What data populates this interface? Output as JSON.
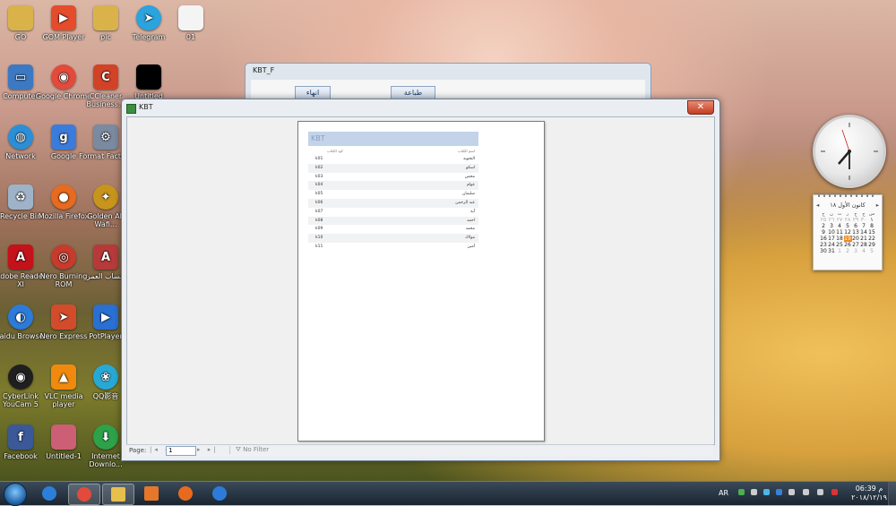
{
  "desktop": {
    "icons": [
      {
        "label": "GO",
        "icon": "folder-icon",
        "color": "#d9b34a"
      },
      {
        "label": "GOM Player",
        "icon": "gom-player-icon",
        "color": "#e44c2c"
      },
      {
        "label": "pic",
        "icon": "folder-icon",
        "color": "#d9b34a"
      },
      {
        "label": "Telegram",
        "icon": "telegram-icon",
        "color": "#2aa3de"
      },
      {
        "label": "01",
        "icon": "document-icon",
        "color": "#f4f4f4"
      },
      {
        "label": "Computer",
        "icon": "computer-icon",
        "color": "#3d79c2"
      },
      {
        "label": "Google Chrome",
        "icon": "chrome-icon",
        "color": "#e24b3b"
      },
      {
        "label": "CCleaner Business...",
        "icon": "ccleaner-icon",
        "color": "#d24226"
      },
      {
        "label": "Untitled",
        "icon": "black-image-icon",
        "color": "#000000"
      },
      {
        "label": "Network",
        "icon": "network-icon",
        "color": "#2b8fd8"
      },
      {
        "label": "Google",
        "icon": "google-icon",
        "color": "#3b7cdb"
      },
      {
        "label": "Format Factory",
        "icon": "format-factory-icon",
        "color": "#7a8aa0"
      },
      {
        "label": "Recycle Bin",
        "icon": "recycle-bin-icon",
        "color": "#9fb3c8"
      },
      {
        "label": "Mozilla Firefox",
        "icon": "firefox-icon",
        "color": "#e86a1e"
      },
      {
        "label": "Golden Al-Wafi...",
        "icon": "golden-al-wafi-icon",
        "color": "#c8951c"
      },
      {
        "label": "Adobe Reader XI",
        "icon": "adobe-reader-icon",
        "color": "#c4121a"
      },
      {
        "label": "Nero Burning ROM",
        "icon": "nero-icon",
        "color": "#c63b2c"
      },
      {
        "label": "حساب العمر",
        "icon": "access-file-icon",
        "color": "#b73a3a"
      },
      {
        "label": "Baidu Browser",
        "icon": "baidu-browser-icon",
        "color": "#2d7bd8"
      },
      {
        "label": "Nero Express",
        "icon": "nero-express-icon",
        "color": "#d24c2c"
      },
      {
        "label": "PotPlayer",
        "icon": "potplayer-icon",
        "color": "#2a6fd2"
      },
      {
        "label": "CyberLink YouCam 5",
        "icon": "youcam-icon",
        "color": "#1f1f1f"
      },
      {
        "label": "VLC media player",
        "icon": "vlc-icon",
        "color": "#f08a0e"
      },
      {
        "label": "QQ影音",
        "icon": "qq-player-icon",
        "color": "#27a9d6"
      },
      {
        "label": "Facebook",
        "icon": "facebook-icon",
        "color": "#3b5998"
      },
      {
        "label": "Untitled-1",
        "icon": "photoshop-file-icon",
        "color": "#cc5f75"
      },
      {
        "label": "Internet Downlo...",
        "icon": "internet-download-manager-icon",
        "color": "#2ea24a"
      }
    ]
  },
  "kbt_f_window": {
    "title": "KBT_F",
    "buttons": [
      "انهاء",
      "طباعة"
    ]
  },
  "report_window": {
    "title": "KBT",
    "close_glyph": "✕",
    "report": {
      "header": "KBT",
      "columns": [
        "كود الكتاب",
        "اسم الكتاب"
      ],
      "rows": [
        {
          "code": "k01",
          "name": "النحويه"
        },
        {
          "code": "k02",
          "name": "اسكو"
        },
        {
          "code": "k03",
          "name": "محمن"
        },
        {
          "code": "k04",
          "name": "عوام"
        },
        {
          "code": "k05",
          "name": "سلیمان"
        },
        {
          "code": "k06",
          "name": "عبد الرحمن"
        },
        {
          "code": "k07",
          "name": "آیة"
        },
        {
          "code": "k08",
          "name": "احمد"
        },
        {
          "code": "k09",
          "name": "محمد"
        },
        {
          "code": "k10",
          "name": "مولاك"
        },
        {
          "code": "k11",
          "name": "آمين"
        }
      ]
    },
    "navigation": {
      "page_label": "Page:",
      "page_value": "1",
      "filter_label": "No Filter"
    }
  },
  "gadgets": {
    "calendar": {
      "month": "كانون الأول ١٨",
      "weekdays": [
        "ح",
        "ن",
        "ث",
        "ر",
        "خ",
        "ج",
        "س"
      ],
      "weeks": [
        [
          "٢٥",
          "٢٦",
          "٢٧",
          "٢٨",
          "٢٩",
          "٣٠",
          "١"
        ],
        [
          "2",
          "3",
          "4",
          "5",
          "6",
          "7",
          "8"
        ],
        [
          "9",
          "10",
          "11",
          "12",
          "13",
          "14",
          "15"
        ],
        [
          "16",
          "17",
          "18",
          "19",
          "20",
          "21",
          "22"
        ],
        [
          "23",
          "24",
          "25",
          "26",
          "27",
          "28",
          "29"
        ],
        [
          "30",
          "31",
          "1",
          "2",
          "3",
          "4",
          "5"
        ]
      ],
      "today": "19"
    }
  },
  "taskbar": {
    "language": "AR",
    "time": "06:39 م",
    "date": "٢٠١٨/١٢/١٩",
    "apps": [
      {
        "icon": "internet-explorer-icon",
        "color": "#2c7fd8"
      },
      {
        "icon": "chrome-icon",
        "color": "#e24b3b"
      },
      {
        "icon": "file-explorer-icon",
        "color": "#e6bf4d"
      },
      {
        "icon": "media-player-icon",
        "color": "#e6762a"
      },
      {
        "icon": "firefox-icon",
        "color": "#e86a1e"
      },
      {
        "icon": "baidu-browser-icon",
        "color": "#2d7bd8"
      }
    ]
  }
}
